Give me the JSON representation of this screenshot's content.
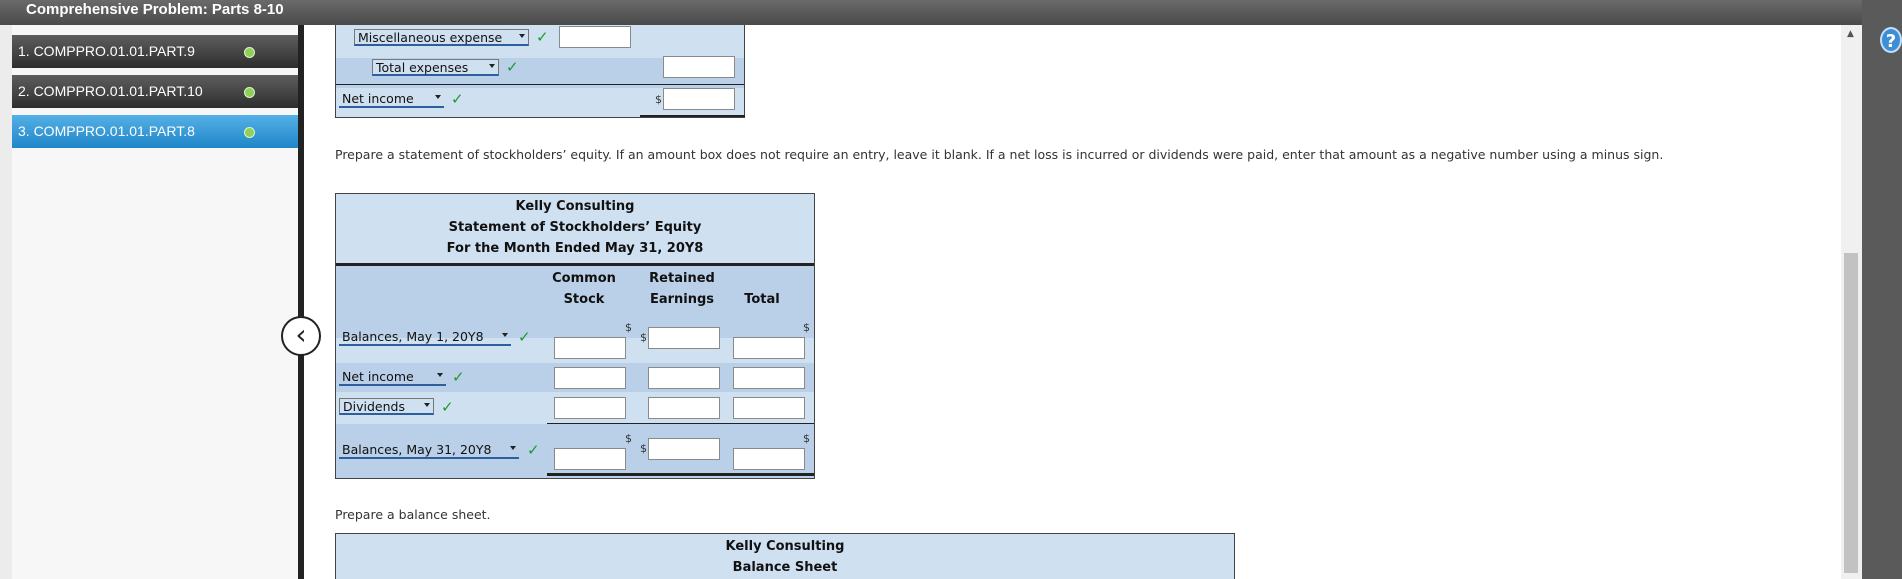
{
  "window": {
    "title": "Comprehensive Problem: Parts 8-10"
  },
  "sidebar": {
    "items": [
      {
        "label": "1. COMPPRO.01.01.PART.9"
      },
      {
        "label": "2. COMPPRO.01.01.PART.10"
      },
      {
        "label": "3. COMPPRO.01.01.PART.8"
      }
    ]
  },
  "income_statement": {
    "misc_expense": "Miscellaneous expense",
    "total_expenses": "Total expenses",
    "net_income": "Net income",
    "dollar": "$"
  },
  "instructions": {
    "equity": "Prepare a statement of stockholders’ equity. If an amount box does not require an entry, leave it blank. If a net loss is incurred or dividends were paid, enter that amount as a negative number using a minus sign.",
    "balance": "Prepare a balance sheet."
  },
  "equity_statement": {
    "company": "Kelly Consulting",
    "title": "Statement of Stockholders’ Equity",
    "period": "For the Month Ended May 31, 20Y8",
    "col1_line1": "Common",
    "col1_line2": "Stock",
    "col2_line1": "Retained",
    "col2_line2": "Earnings",
    "col3": "Total",
    "dollar": "$",
    "rows": {
      "balance_begin": "Balances, May 1, 20Y8",
      "net_income": "Net income",
      "dividends": "Dividends",
      "balance_end": "Balances, May 31, 20Y8"
    }
  },
  "balance_sheet": {
    "company": "Kelly Consulting",
    "title": "Balance Sheet"
  },
  "colors": {
    "accent": "#1f86c8",
    "panel": "#cfe0f1",
    "band": "#b9d0e8",
    "check": "#1e9a2c"
  }
}
